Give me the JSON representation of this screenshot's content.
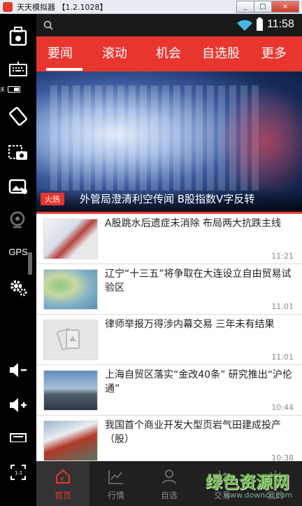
{
  "window": {
    "title": "天天模拟器 【1.2.1028】",
    "buttons": {
      "minimize": "_",
      "maximize": "□",
      "close": "×"
    }
  },
  "toolbar": {
    "gps_label": "GPS",
    "toggle_label": "关"
  },
  "statusbar": {
    "time": "11:58"
  },
  "tabs": [
    {
      "label": "要闻",
      "active": true
    },
    {
      "label": "滚动",
      "active": false
    },
    {
      "label": "机会",
      "active": false
    },
    {
      "label": "自选股",
      "active": false
    },
    {
      "label": "更多",
      "active": false
    }
  ],
  "hero": {
    "badge": "火热",
    "title": "外管局澄清利空传闻 B股指数V字反转"
  },
  "news": [
    {
      "title": "A股跳水后遗症未消除 布局两大抗跌主线",
      "time": "11:21"
    },
    {
      "title": "辽宁“十三五”将争取在大连设立自由贸易试验区",
      "time": "11:01"
    },
    {
      "title": "律师举报万得涉内幕交易 三年未有结果",
      "time": "11:01"
    },
    {
      "title": "上海自贸区落实“金改40条” 研究推出“沪伦通”",
      "time": "10:44"
    },
    {
      "title": "我国首个商业开发大型页岩气田建成投产（股）",
      "time": "10:38"
    }
  ],
  "bottom_nav": [
    {
      "label": "首页",
      "icon": "home-icon",
      "active": true
    },
    {
      "label": "行情",
      "icon": "chart-icon",
      "active": false
    },
    {
      "label": "自选",
      "icon": "person-icon",
      "active": false
    },
    {
      "label": "交易",
      "icon": "trade-icon",
      "active": false
    },
    {
      "label": "我的",
      "icon": "eye-icon",
      "active": false
    }
  ],
  "watermark": {
    "text": "绿色资源网",
    "url": "www.downcc.com"
  },
  "colors": {
    "accent": "#e8362f",
    "statusbar": "#1a1a1a",
    "nav_bg": "#202020"
  }
}
